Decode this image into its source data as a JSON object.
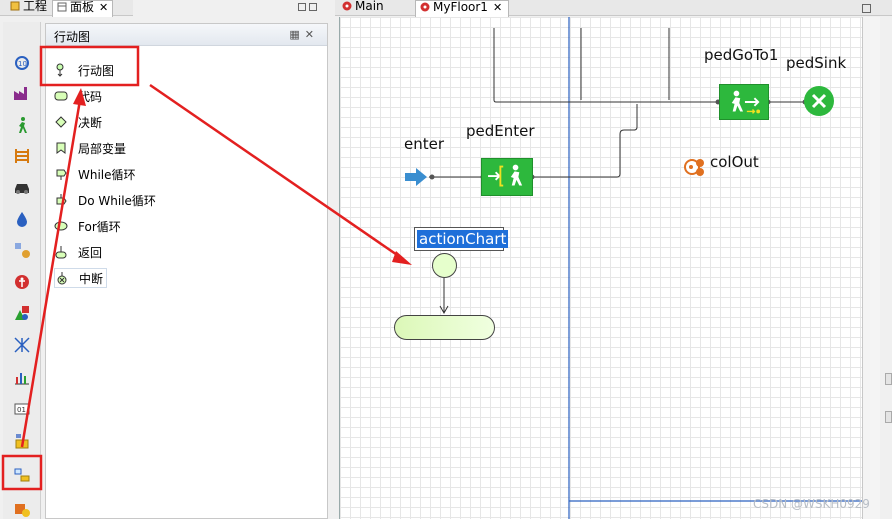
{
  "left_tabs": {
    "project": "工程",
    "palette": "面板"
  },
  "palette_panel": {
    "title": "行动图",
    "items": [
      {
        "label": "行动图",
        "icon": "action-chart-icon"
      },
      {
        "label": "代码",
        "icon": "code-icon"
      },
      {
        "label": "决断",
        "icon": "decision-icon"
      },
      {
        "label": "局部变量",
        "icon": "local-variable-icon"
      },
      {
        "label": "While循环",
        "icon": "while-loop-icon"
      },
      {
        "label": "Do While循环",
        "icon": "do-while-loop-icon"
      },
      {
        "label": "For循环",
        "icon": "for-loop-icon"
      },
      {
        "label": "返回",
        "icon": "return-icon"
      },
      {
        "label": "中断",
        "icon": "break-icon"
      }
    ]
  },
  "editor_tabs": {
    "main": "Main",
    "floor": "MyFloor1"
  },
  "canvas": {
    "pedGoTo": "pedGoTo1",
    "pedSink": "pedSink",
    "enter": "enter",
    "pedEnter": "pedEnter",
    "colOut": "colOut",
    "actionChart": "actionChart"
  },
  "watermark": "CSDN @WSKH0929",
  "colors": {
    "annotation_red": "#e32020",
    "block_green": "#2db83d",
    "selection_blue": "#1e6fd9"
  }
}
